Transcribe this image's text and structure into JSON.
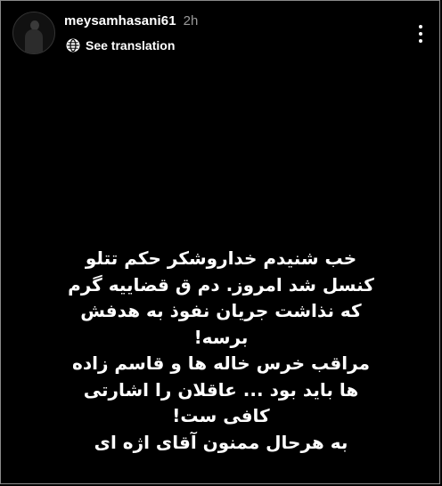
{
  "header": {
    "username": "meysamhasani61",
    "timestamp": "2h",
    "translate_label": "See translation"
  },
  "story": {
    "lines": [
      "خب شنیدم خداروشکر حکم تتلو",
      "کنسل شد امروز. دم ق قضاییه گرم",
      "که نذاشت جریان نفوذ به هدفش",
      "برسه!",
      "مراقب خرس خاله ها و قاسم زاده",
      "ها باید بود ... عاقلان را اشارتی",
      "کافی ست!",
      "به هرحال ممنون آقای اژه ای"
    ]
  },
  "icons": {
    "avatar": "profile-avatar",
    "translate": "globe-icon",
    "menu": "more-vertical-icon"
  },
  "colors": {
    "background": "#000000",
    "text": "#ffffff",
    "muted": "#9a9a9a"
  }
}
